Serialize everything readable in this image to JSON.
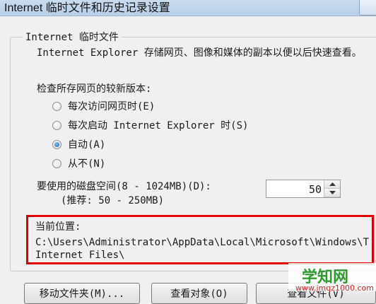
{
  "window": {
    "title": "Internet 临时文件和历史记录设置"
  },
  "group": {
    "legend": "Internet 临时文件",
    "description": "Internet Explorer 存储网页、图像和媒体的副本以便以后快速查看。"
  },
  "check": {
    "title": "检查所存网页的较新版本:",
    "options": [
      {
        "label": "每次访问网页时(E)",
        "checked": false
      },
      {
        "label": "每次启动 Internet Explorer 时(S)",
        "checked": false
      },
      {
        "label": "自动(A)",
        "checked": true
      },
      {
        "label": "从不(N)",
        "checked": false
      }
    ]
  },
  "disk": {
    "label": "要使用的磁盘空间(8 - 1024MB)(D):",
    "hint": "(推荐: 50 - 250MB)",
    "value": "50"
  },
  "location": {
    "title": "当前位置:",
    "path_line1": "C:\\Users\\Administrator\\AppData\\Local\\Microsoft\\Windows\\Temporary",
    "path_line2": "Internet Files\\"
  },
  "buttons": {
    "move_folder": "移动文件夹(M)...",
    "view_objects": "查看对象(O)",
    "view_files": "查看文件(V)"
  },
  "watermark": {
    "text": "学知网",
    "url": "www.jmqz1000.com"
  },
  "colors": {
    "highlight_border": "#e00000",
    "radio_selected": "#1b5fb0",
    "watermark_green": "#2e9b2e"
  }
}
